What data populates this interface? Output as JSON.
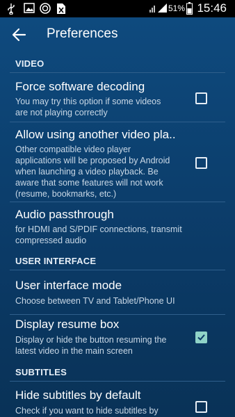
{
  "status_bar": {
    "time": "15:46",
    "battery_percent": "51%",
    "icons": [
      "usb-icon",
      "image-icon",
      "vlc-app-icon",
      "file-excel-icon",
      "wifi-icon",
      "signal-icon",
      "battery-icon"
    ]
  },
  "app_bar": {
    "title": "Preferences",
    "back_icon": "arrow-back-icon"
  },
  "sections": [
    {
      "header": "VIDEO"
    },
    {
      "header": "USER INTERFACE"
    },
    {
      "header": "SUBTITLES"
    }
  ],
  "prefs": [
    {
      "title": "Force software decoding",
      "summary_lines": [
        "You may try this option if some videos",
        "are not playing correctly"
      ],
      "checked": false
    },
    {
      "title": "Allow using another video pla..",
      "summary_lines": [
        "Other compatible video player",
        "applications will be proposed by Android",
        "when launching a video playback. Be",
        "aware that some features will not work",
        "(resume, bookmarks, etc.)"
      ],
      "checked": false
    },
    {
      "title": "Audio passthrough",
      "summary_lines": [
        "for HDMI and S/PDIF connections, transmit",
        "compressed audio"
      ]
    },
    {
      "title": "User interface mode",
      "summary_lines": [
        "Choose between TV and Tablet/Phone UI"
      ]
    },
    {
      "title": "Display resume box",
      "summary_lines": [
        "Display or hide the button resuming the",
        "latest video in the main screen"
      ],
      "checked": true
    },
    {
      "title": "Hide subtitles by default",
      "summary_lines": [
        "Check if you want to hide subtitles by"
      ],
      "checked": false
    }
  ],
  "colors": {
    "background": "#0d3f6e",
    "checkbox_checked": "#8fd3c7"
  }
}
